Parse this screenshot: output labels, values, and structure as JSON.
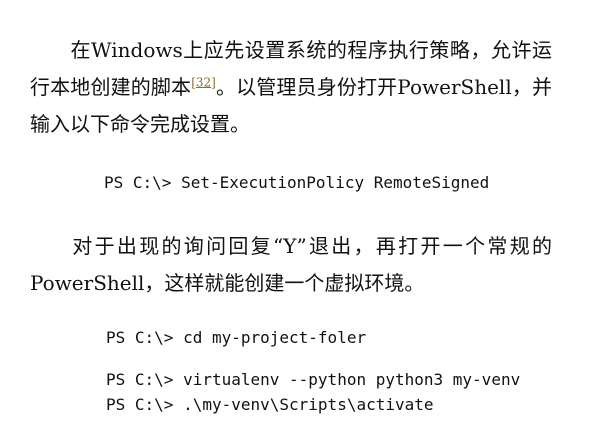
{
  "paragraph1": {
    "text_before_cite": "在Windows上应先设置系统的程序执行策略，允许运行本地创建的脚本",
    "citation": "[32]",
    "text_after_cite": "。以管理员身份打开PowerShell，并输入以下命令完成设置。"
  },
  "code1": "PS C:\\> Set-ExecutionPolicy RemoteSigned",
  "paragraph2": "对于出现的询问回复“Y”退出，再打开一个常规的PowerShell，这样就能创建一个虚拟环境。",
  "code2": [
    "PS C:\\> cd my-project-foler",
    "PS C:\\> virtualenv --python python3 my-venv",
    "PS C:\\> .\\my-venv\\Scripts\\activate"
  ]
}
